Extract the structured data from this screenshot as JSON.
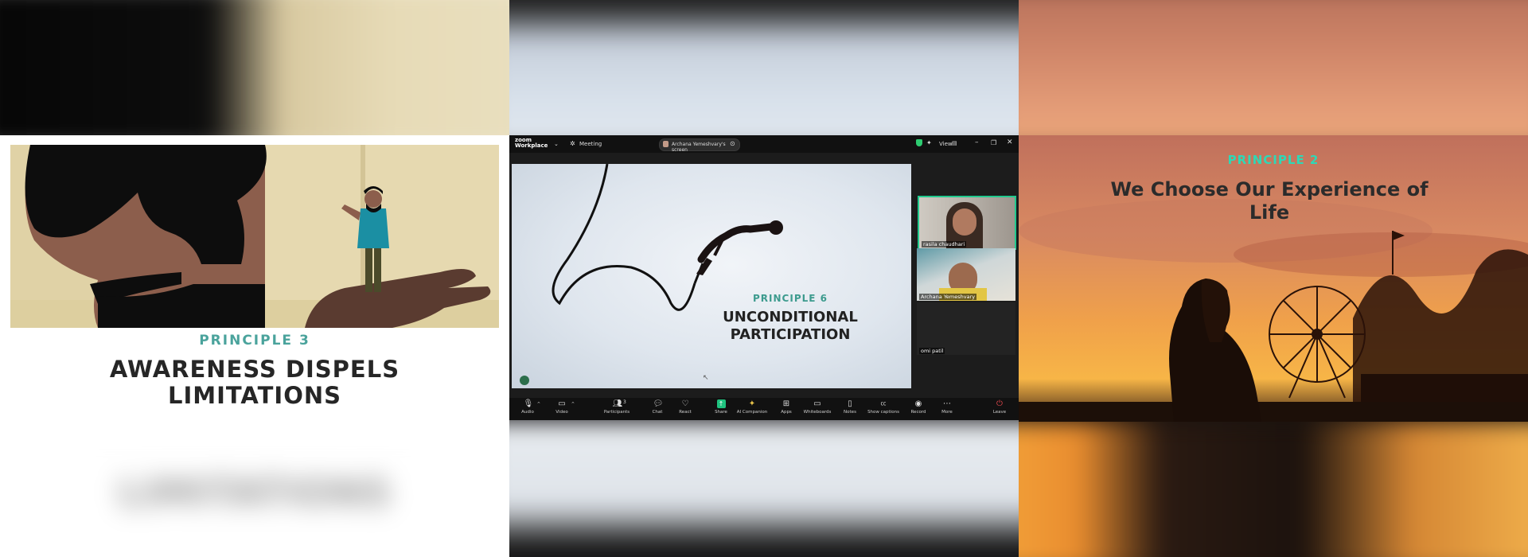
{
  "left_slide": {
    "principle": "PRINCIPLE 3",
    "headline_line1": "AWARENESS DISPELS",
    "headline_line2": "LIMITATIONS",
    "ghost_text": "LIMITATIONS"
  },
  "zoom": {
    "app_name_line1": "zoom",
    "app_name_line2": "Workplace",
    "meeting_label": "Meeting",
    "share_label": "Archana Yemeshvary's screen",
    "view_label": "View",
    "slide": {
      "principle": "PRINCIPLE 6",
      "headline_line1": "UNCONDITIONAL",
      "headline_line2": "PARTICIPATION"
    },
    "participants": [
      {
        "name": "rasila chaudhari"
      },
      {
        "name": "Archana Yemeshvary"
      },
      {
        "name": "omi patil"
      }
    ],
    "participant_count": "3",
    "toolbar": [
      {
        "label": "Audio",
        "icon": "mic-icon"
      },
      {
        "label": "Video",
        "icon": "camera-icon"
      },
      {
        "label": "Participants",
        "icon": "participants-icon"
      },
      {
        "label": "Chat",
        "icon": "chat-icon"
      },
      {
        "label": "React",
        "icon": "heart-icon"
      },
      {
        "label": "Share",
        "icon": "share-icon"
      },
      {
        "label": "AI Companion",
        "icon": "sparkle-icon"
      },
      {
        "label": "Apps",
        "icon": "apps-icon"
      },
      {
        "label": "Whiteboards",
        "icon": "whiteboard-icon"
      },
      {
        "label": "Notes",
        "icon": "notes-icon"
      },
      {
        "label": "Show captions",
        "icon": "cc-icon"
      },
      {
        "label": "Record",
        "icon": "record-icon"
      },
      {
        "label": "More",
        "icon": "more-icon"
      },
      {
        "label": "Leave",
        "icon": "leave-icon"
      }
    ],
    "colors": {
      "accent": "#21c98d",
      "share": "#1fc27f",
      "leave": "#e5484d"
    }
  },
  "right_slide": {
    "principle": "PRINCIPLE 2",
    "headline_line1": "We Choose Our Experience of",
    "headline_line2": "Life"
  }
}
